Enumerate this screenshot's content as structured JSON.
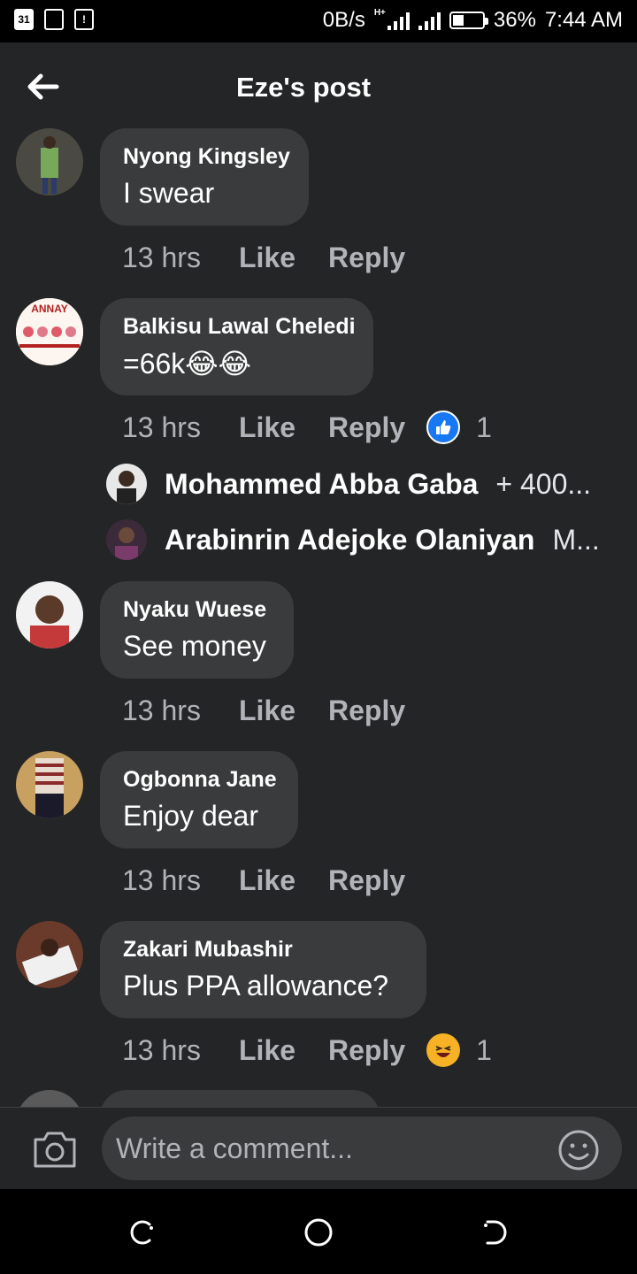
{
  "status_bar": {
    "left_icons": [
      "calendar-icon",
      "cast-icon",
      "alert-icon"
    ],
    "calendar_day": "31",
    "net_speed": "0B/s",
    "network_type": "H+",
    "battery": "36%",
    "time": "7:44 AM"
  },
  "header": {
    "title": "Eze's post"
  },
  "comments": [
    {
      "name": "Nyong Kingsley",
      "text": "I swear",
      "time": "13 hrs",
      "like": "Like",
      "reply": "Reply"
    },
    {
      "name": "Balkisu Lawal Cheledi",
      "text": "=66k😂😂",
      "time": "13 hrs",
      "like": "Like",
      "reply": "Reply",
      "reaction": {
        "type": "like-icon",
        "count": "1"
      }
    },
    {
      "name": "Nyaku Wuese",
      "text": "See money",
      "time": "13 hrs",
      "like": "Like",
      "reply": "Reply"
    },
    {
      "name": "Ogbonna Jane",
      "text": "Enjoy dear",
      "time": "13 hrs",
      "like": "Like",
      "reply": "Reply"
    },
    {
      "name": "Zakari Mubashir",
      "text": "Plus PPA allowance?",
      "time": "13 hrs",
      "like": "Like",
      "reply": "Reply",
      "reaction": {
        "type": "haha-icon",
        "count": "1"
      }
    }
  ],
  "replies": [
    {
      "name": "Mohammed Abba Gaba",
      "snippet": "+ 400..."
    },
    {
      "name": "Arabinrin Adejoke Olaniyan",
      "snippet": "M..."
    }
  ],
  "avatar_logo_text": "ANNAY",
  "composer": {
    "placeholder": "Write a comment..."
  },
  "colors": {
    "background": "#242526",
    "bubble": "#3a3b3c",
    "muted_text": "#b0b3b8",
    "like_blue": "#1877f2",
    "haha_yellow": "#f7b125"
  }
}
